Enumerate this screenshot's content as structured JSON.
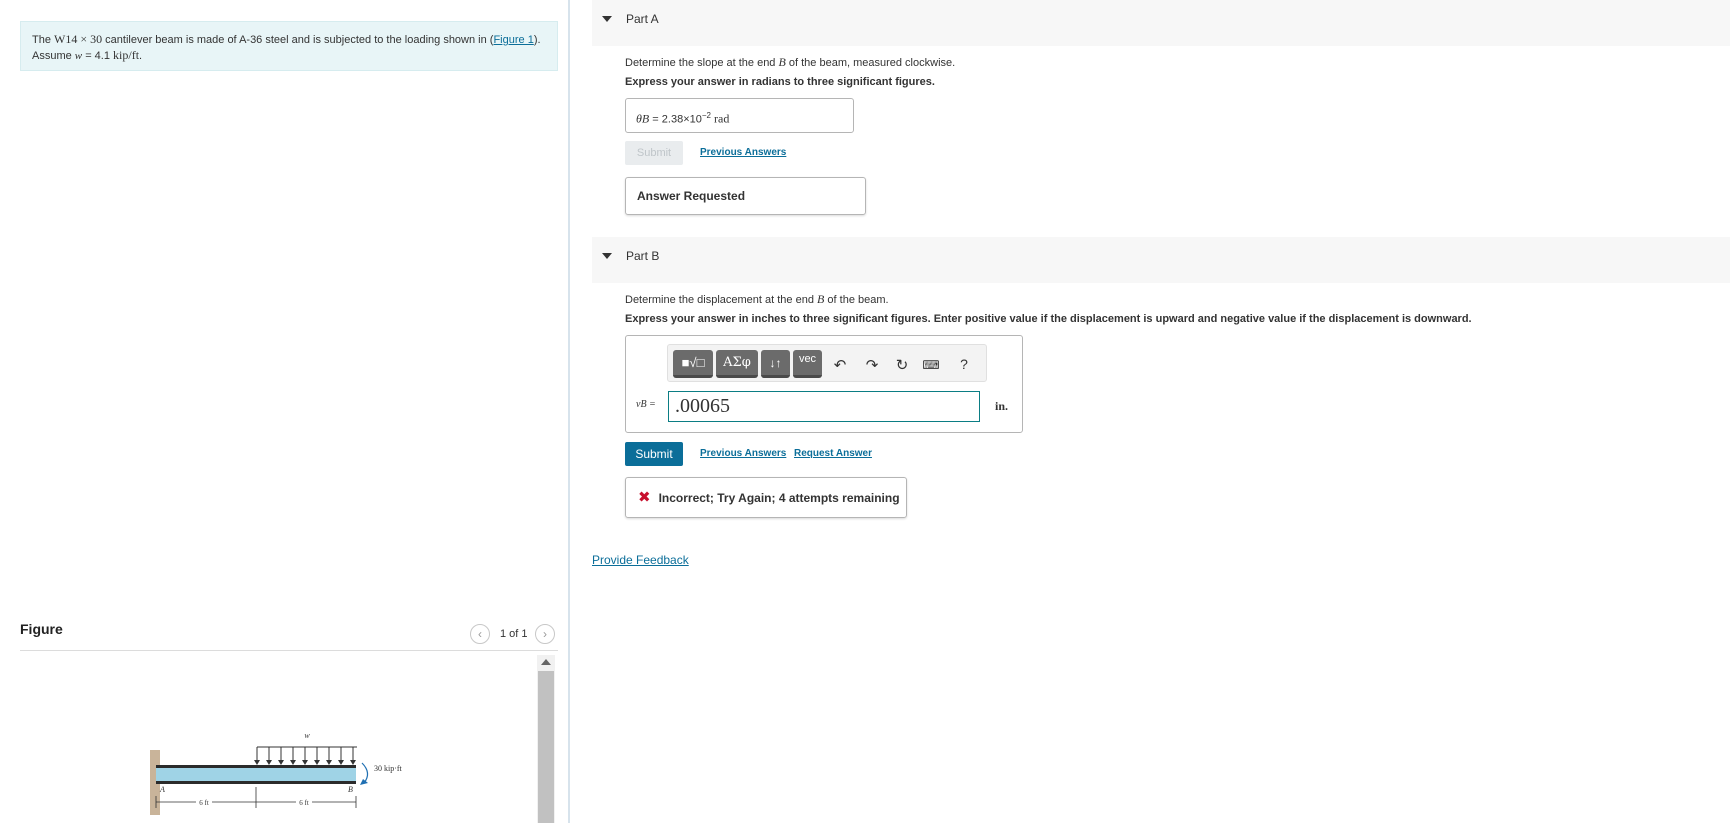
{
  "problem": {
    "text_before": "The ",
    "beam_designation": "W14 × 30",
    "text_middle": " cantilever beam is made of A-36 steel and is subjected to the loading shown in (",
    "figure_link": "Figure 1",
    "text_after": ").",
    "assume_prefix": "Assume ",
    "w_symbol": "w",
    "assume_mid": " = 4.1 ",
    "assume_unit": "kip/ft",
    "assume_end": "."
  },
  "figure": {
    "header": "Figure",
    "counter": "1 of 1",
    "prev_icon": "chevron-left-icon",
    "next_icon": "chevron-right-icon",
    "labels": {
      "w": "w",
      "moment": "30 kip·ft",
      "A": "A",
      "B": "B",
      "dim1": "6 ft",
      "dim2": "6 ft"
    }
  },
  "partA": {
    "title": "Part A",
    "question_pre": "Determine the slope at the end ",
    "question_var": "B",
    "question_post": " of the beam, measured clockwise.",
    "instruction": "Express your answer in radians to three significant figures.",
    "answer_symbol": "θB",
    "answer_eq": " = ",
    "answer_mantissa": "2.38×10",
    "answer_exp": "−2",
    "answer_unit": "rad",
    "submit_label": "Submit",
    "previous_answers_label": "Previous Answers",
    "status": "Answer Requested"
  },
  "partB": {
    "title": "Part B",
    "question_pre": "Determine the displacement at the end ",
    "question_var": "B",
    "question_post": " of the beam.",
    "instruction": "Express your answer in inches to three significant figures. Enter positive value if the displacement is upward and negative value if the displacement is downward.",
    "toolbar": {
      "templates": "■√□",
      "greek": "ΑΣφ",
      "arrows": "↓↑",
      "vec": "vec",
      "undo_icon": "undo-icon",
      "redo_icon": "redo-icon",
      "reset_icon": "reset-icon",
      "keyboard_icon": "keyboard-icon",
      "help": "?"
    },
    "input_label": "vB =",
    "input_value": ".00065",
    "unit": "in.",
    "submit_label": "Submit",
    "previous_answers_label": "Previous Answers",
    "request_answer_label": "Request Answer",
    "feedback": "Incorrect; Try Again; 4 attempts remaining"
  },
  "provide_feedback": "Provide Feedback",
  "colors": {
    "accent": "#0b6e99",
    "error": "#c8102e",
    "problem_bg": "#e8f5f7",
    "beam": "#9fd3e6"
  }
}
